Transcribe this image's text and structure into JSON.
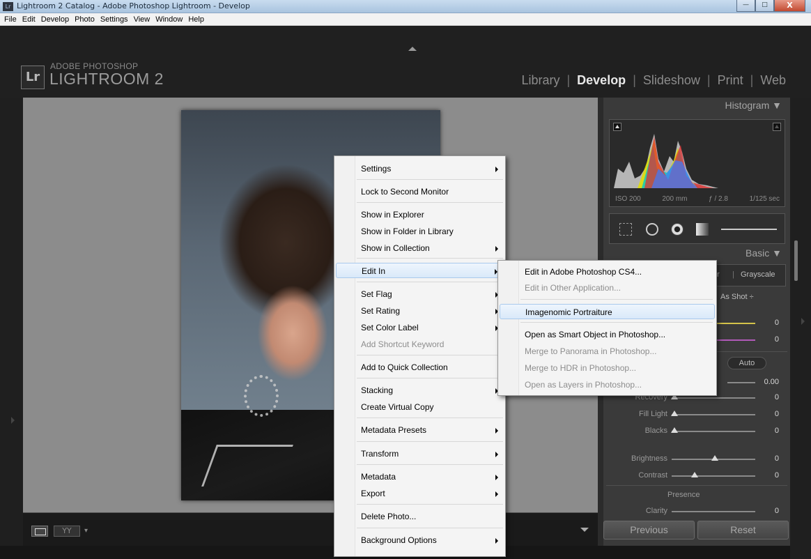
{
  "window": {
    "icon_label": "Lr",
    "title": "Lightroom 2 Catalog - Adobe Photoshop Lightroom - Develop",
    "buttons": {
      "minimize": "—",
      "maximize": "□",
      "close": "X"
    }
  },
  "menubar": [
    "File",
    "Edit",
    "Develop",
    "Photo",
    "Settings",
    "View",
    "Window",
    "Help"
  ],
  "identity": {
    "badge": "Lr",
    "line1": "ADOBE PHOTOSHOP",
    "line2": "LIGHTROOM 2"
  },
  "modules": [
    {
      "label": "Library",
      "active": false
    },
    {
      "label": "Develop",
      "active": true
    },
    {
      "label": "Slideshow",
      "active": false
    },
    {
      "label": "Print",
      "active": false
    },
    {
      "label": "Web",
      "active": false
    }
  ],
  "module_separator": "|",
  "toolbar": {
    "yy_label": "YY",
    "dropdown": "▾"
  },
  "right_panel": {
    "histogram_title": "Histogram ▼",
    "exif": [
      "ISO 200",
      "200 mm",
      "ƒ / 2.8",
      "1/125 sec"
    ],
    "basic_title": "Basic ▼",
    "treatment_color": "r",
    "treatment_sep": "|",
    "treatment_gray": "Grayscale",
    "wb_value": "As Shot ÷",
    "temp_value": "0",
    "tint_value": "0",
    "auto": "Auto",
    "exposure_value": "0.00",
    "sliders": [
      {
        "label": "Recovery",
        "value": "0",
        "pos": 0.0
      },
      {
        "label": "Fill Light",
        "value": "0",
        "pos": 0.0
      },
      {
        "label": "Blacks",
        "value": "0",
        "pos": 0.0
      },
      {
        "label": "Brightness",
        "value": "0",
        "pos": 0.5
      },
      {
        "label": "Contrast",
        "value": "0",
        "pos": 0.25
      }
    ],
    "presence": "Presence",
    "clarity": "Clarity",
    "clarity_value": "0",
    "previous": "Previous",
    "reset": "Reset"
  },
  "context_menu": {
    "items": [
      {
        "label": "Settings",
        "submenu": true,
        "disabled": false
      },
      {
        "label": "Lock to Second Monitor",
        "submenu": false,
        "disabled": false
      },
      {
        "label": "Show in Explorer",
        "submenu": false,
        "disabled": false
      },
      {
        "label": "Show in Folder in Library",
        "submenu": false,
        "disabled": false
      },
      {
        "label": "Show in Collection",
        "submenu": true,
        "disabled": false
      },
      {
        "label": "Edit In",
        "submenu": true,
        "disabled": false,
        "highlighted": true
      },
      {
        "label": "Set Flag",
        "submenu": true,
        "disabled": false
      },
      {
        "label": "Set Rating",
        "submenu": true,
        "disabled": false
      },
      {
        "label": "Set Color Label",
        "submenu": true,
        "disabled": false
      },
      {
        "label": "Add Shortcut Keyword",
        "submenu": false,
        "disabled": true
      },
      {
        "label": "Add to Quick Collection",
        "submenu": false,
        "disabled": false
      },
      {
        "label": "Stacking",
        "submenu": true,
        "disabled": false
      },
      {
        "label": "Create Virtual Copy",
        "submenu": false,
        "disabled": false
      },
      {
        "label": "Metadata Presets",
        "submenu": true,
        "disabled": false
      },
      {
        "label": "Transform",
        "submenu": true,
        "disabled": false
      },
      {
        "label": "Metadata",
        "submenu": true,
        "disabled": false
      },
      {
        "label": "Export",
        "submenu": true,
        "disabled": false
      },
      {
        "label": "Delete Photo...",
        "submenu": false,
        "disabled": false
      },
      {
        "label": "Background Options",
        "submenu": true,
        "disabled": false
      }
    ]
  },
  "edit_in_submenu": {
    "items": [
      {
        "label": "Edit in Adobe Photoshop CS4...",
        "disabled": false
      },
      {
        "label": "Edit in Other Application...",
        "disabled": true
      },
      {
        "label": "Imagenomic Portraiture",
        "disabled": false,
        "highlighted": true
      },
      {
        "label": "Open as Smart Object in Photoshop...",
        "disabled": false
      },
      {
        "label": "Merge to Panorama in Photoshop...",
        "disabled": true
      },
      {
        "label": "Merge to HDR in Photoshop...",
        "disabled": true
      },
      {
        "label": "Open as Layers in Photoshop...",
        "disabled": true
      }
    ]
  },
  "colors": {
    "accent_highlight": "#d9e9f9",
    "active_module": "#e8e8e8"
  }
}
